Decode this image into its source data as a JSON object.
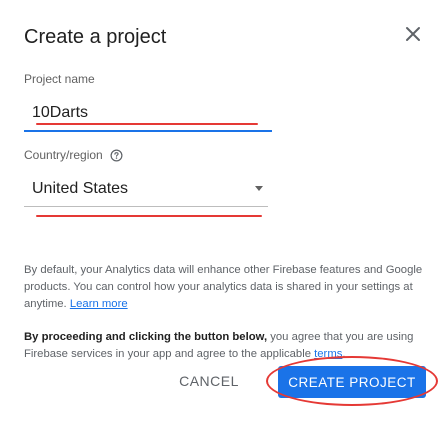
{
  "dialog": {
    "title": "Create a project",
    "close_icon": "close-icon"
  },
  "project_name": {
    "label": "Project name",
    "value": "10Darts"
  },
  "country_region": {
    "label": "Country/region",
    "help_icon": "help-circle-icon",
    "selected": "United States",
    "arrow_icon": "dropdown-arrow-icon"
  },
  "analytics_notice": {
    "text": "By default, your Analytics data will enhance other Firebase features and Google products. You can control how your analytics data is shared in your settings at anytime.",
    "link": "Learn more"
  },
  "terms_notice": {
    "bold": "By proceeding and clicking the button below,",
    "text": "you agree that you are using Firebase services in your app and agree to the applicable",
    "link": "terms",
    "end": "."
  },
  "actions": {
    "cancel_label": "CANCEL",
    "create_label": "CREATE PROJECT"
  },
  "colors": {
    "accent": "#1a73e8",
    "annotation": "#e53935",
    "text_primary": "#212121",
    "text_secondary": "#5f6368"
  }
}
